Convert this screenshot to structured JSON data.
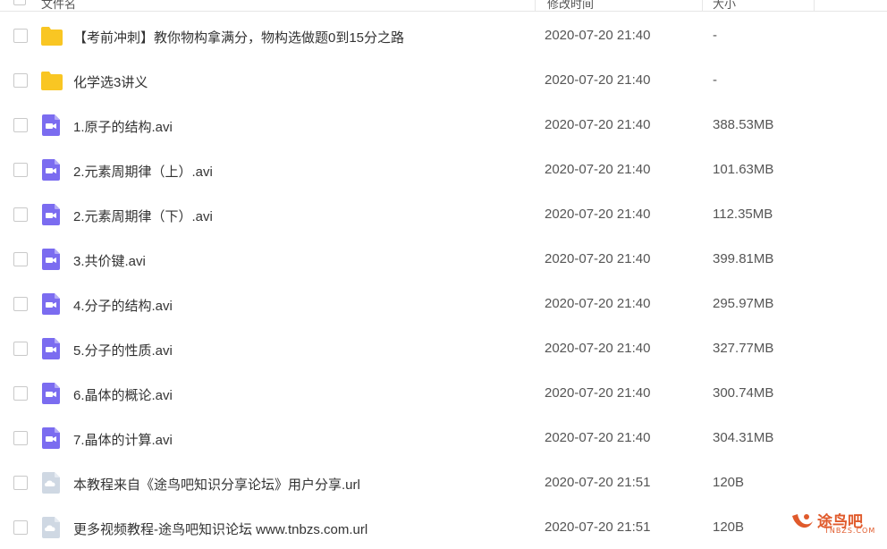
{
  "header": {
    "name_label": "文件名",
    "date_label": "修改时间",
    "size_label": "大小"
  },
  "rows": [
    {
      "name": "【考前冲刺】教你物构拿满分，物构选做题0到15分之路",
      "date": "2020-07-20 21:40",
      "size": "-",
      "icon": "folder-icon"
    },
    {
      "name": "化学选3讲义",
      "date": "2020-07-20 21:40",
      "size": "-",
      "icon": "folder-icon"
    },
    {
      "name": "1.原子的结构.avi",
      "date": "2020-07-20 21:40",
      "size": "388.53MB",
      "icon": "video-file-icon"
    },
    {
      "name": "2.元素周期律（上）.avi",
      "date": "2020-07-20 21:40",
      "size": "101.63MB",
      "icon": "video-file-icon"
    },
    {
      "name": "2.元素周期律（下）.avi",
      "date": "2020-07-20 21:40",
      "size": "112.35MB",
      "icon": "video-file-icon"
    },
    {
      "name": "3.共价键.avi",
      "date": "2020-07-20 21:40",
      "size": "399.81MB",
      "icon": "video-file-icon"
    },
    {
      "name": "4.分子的结构.avi",
      "date": "2020-07-20 21:40",
      "size": "295.97MB",
      "icon": "video-file-icon"
    },
    {
      "name": "5.分子的性质.avi",
      "date": "2020-07-20 21:40",
      "size": "327.77MB",
      "icon": "video-file-icon"
    },
    {
      "name": "6.晶体的概论.avi",
      "date": "2020-07-20 21:40",
      "size": "300.74MB",
      "icon": "video-file-icon"
    },
    {
      "name": "7.晶体的计算.avi",
      "date": "2020-07-20 21:40",
      "size": "304.31MB",
      "icon": "video-file-icon"
    },
    {
      "name": "本教程来自《途鸟吧知识分享论坛》用户分享.url",
      "date": "2020-07-20 21:51",
      "size": "120B",
      "icon": "link-file-icon"
    },
    {
      "name": "更多视频教程-途鸟吧知识论坛 www.tnbzs.com.url",
      "date": "2020-07-20 21:51",
      "size": "120B",
      "icon": "link-file-icon"
    }
  ],
  "watermark": {
    "brand": "途鸟吧",
    "url": "TNBZS.COM"
  },
  "colors": {
    "folder": "#f9c623",
    "video": "#7b6cf0",
    "link": "#cfd8e3",
    "brand": "#e05a2b"
  }
}
